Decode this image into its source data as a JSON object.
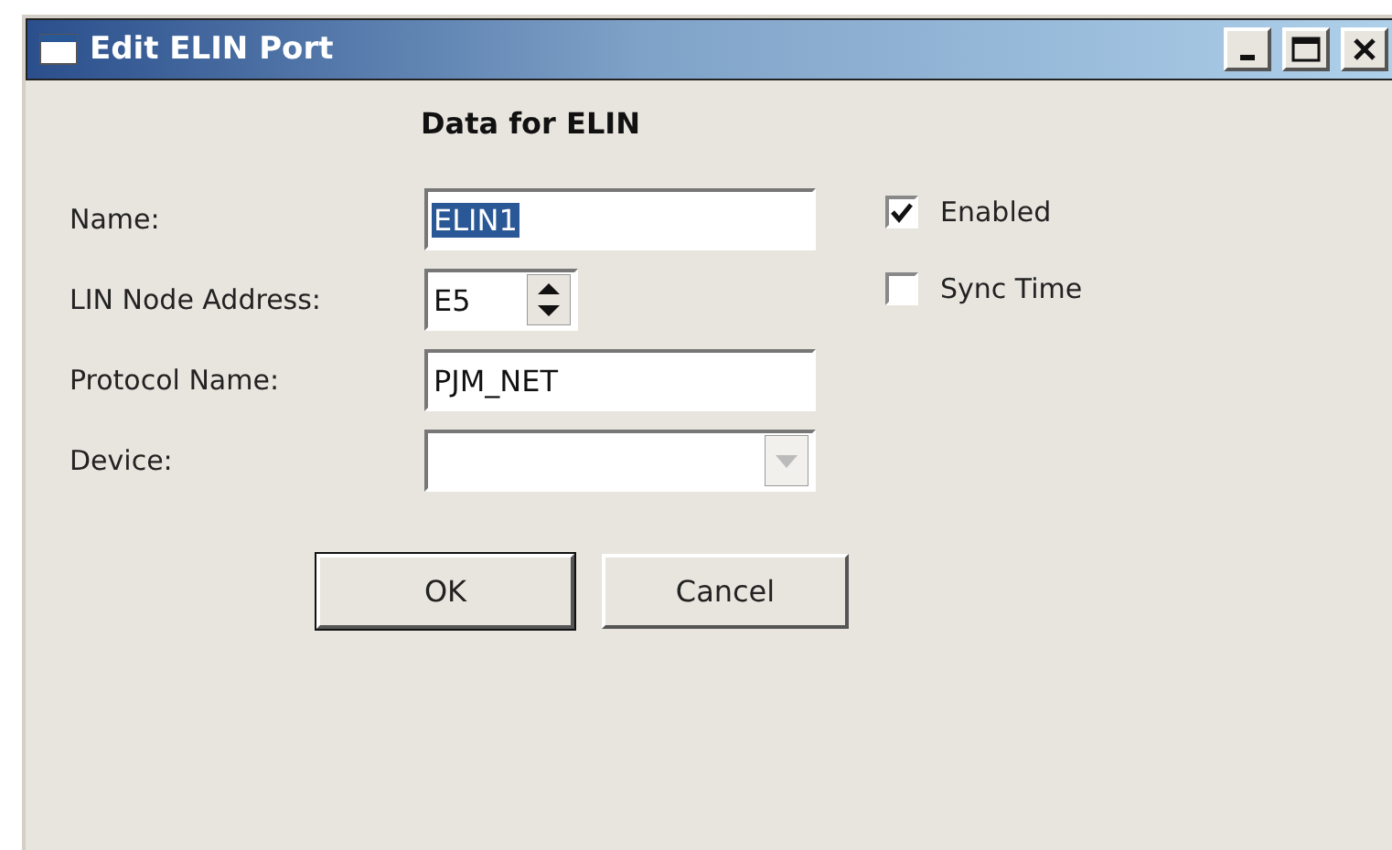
{
  "window": {
    "title": "Edit ELIN Port"
  },
  "heading": "Data for ELIN",
  "fields": [
    {
      "kind": "text",
      "label": "Name:",
      "value": "ELIN1",
      "highlighted": true
    },
    {
      "kind": "spinner",
      "label": "LIN Node Address:",
      "value": "E5",
      "highlighted": false
    },
    {
      "kind": "text",
      "label": "Protocol Name:",
      "value": "PJM_NET",
      "highlighted": false
    },
    {
      "kind": "dropdown",
      "label": "Device:",
      "highlighted": false
    }
  ],
  "checkboxes": [
    {
      "label": "Enabled",
      "checked": true
    },
    {
      "label": "Sync Time",
      "checked": false
    }
  ],
  "buttons": [
    {
      "label": "OK",
      "default": true
    },
    {
      "label": "Cancel",
      "default": false
    }
  ]
}
